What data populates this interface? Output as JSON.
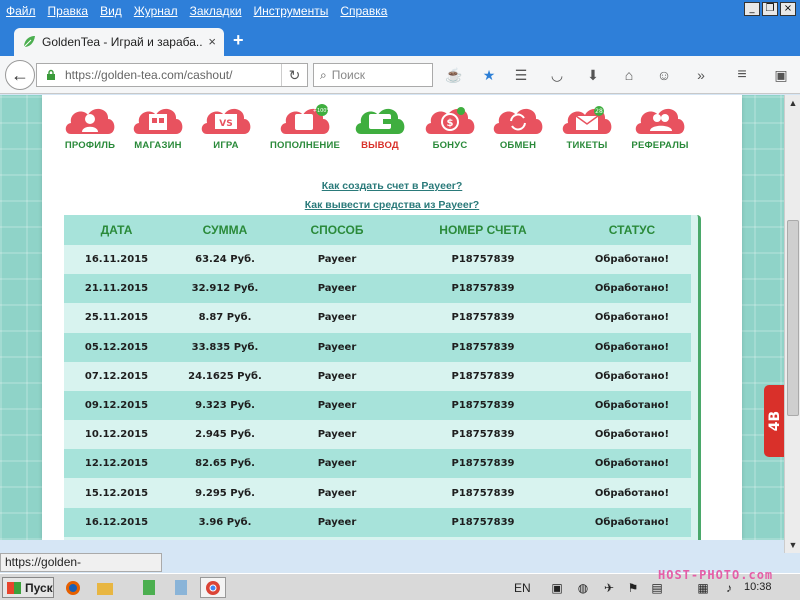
{
  "menubar": {
    "items": [
      "Файл",
      "Правка",
      "Вид",
      "Журнал",
      "Закладки",
      "Инструменты",
      "Справка"
    ]
  },
  "tab": {
    "title": "GoldenTea - Играй и зараба...",
    "close": "×",
    "new_tab": "+"
  },
  "navbar": {
    "url": "https://golden-tea.com/cashout/",
    "search_placeholder": "Поиск"
  },
  "site": {
    "menu": [
      {
        "label": "ПРОФИЛЬ",
        "icon": "profile-icon",
        "color": "#e8525f"
      },
      {
        "label": "МАГАЗИН",
        "icon": "shop-icon",
        "color": "#e8525f"
      },
      {
        "label": "ИГРА",
        "icon": "game-icon",
        "color": "#e8525f",
        "badge": "VS"
      },
      {
        "label": "ПОПОЛНЕНИЕ",
        "icon": "deposit-icon",
        "color": "#e8525f",
        "badge": "+100%"
      },
      {
        "label": "ВЫВОД",
        "icon": "wallet-icon",
        "color": "#3fae3f"
      },
      {
        "label": "БОНУС",
        "icon": "bonus-icon",
        "color": "#e8525f"
      },
      {
        "label": "ОБМЕН",
        "icon": "exchange-icon",
        "color": "#e8525f"
      },
      {
        "label": "ТИКЕТЫ",
        "icon": "tickets-icon",
        "color": "#e8525f",
        "badge": "28"
      },
      {
        "label": "РЕФЕРАЛЫ",
        "icon": "referrals-icon",
        "color": "#e8525f"
      }
    ],
    "links": {
      "create_account": "Как создать счет в Payeer?",
      "withdraw": "Как вывести средства из Payeer?"
    },
    "table": {
      "headers": [
        "ДАТА",
        "СУММА",
        "СПОСОБ",
        "НОМЕР СЧЕТА",
        "СТАТУС"
      ],
      "rows": [
        [
          "16.11.2015",
          "63.24 Руб.",
          "Payeer",
          "P18757839",
          "Обработано!"
        ],
        [
          "21.11.2015",
          "32.912 Руб.",
          "Payeer",
          "P18757839",
          "Обработано!"
        ],
        [
          "25.11.2015",
          "8.87 Руб.",
          "Payeer",
          "P18757839",
          "Обработано!"
        ],
        [
          "05.12.2015",
          "33.835 Руб.",
          "Payeer",
          "P18757839",
          "Обработано!"
        ],
        [
          "07.12.2015",
          "24.1625 Руб.",
          "Payeer",
          "P18757839",
          "Обработано!"
        ],
        [
          "09.12.2015",
          "9.323 Руб.",
          "Payeer",
          "P18757839",
          "Обработано!"
        ],
        [
          "10.12.2015",
          "2.945 Руб.",
          "Payeer",
          "P18757839",
          "Обработано!"
        ],
        [
          "12.12.2015",
          "82.65 Руб.",
          "Payeer",
          "P18757839",
          "Обработано!"
        ],
        [
          "15.12.2015",
          "9.295 Руб.",
          "Payeer",
          "P18757839",
          "Обработано!"
        ],
        [
          "16.12.2015",
          "3.96 Руб.",
          "Payeer",
          "P18757839",
          "Обработано!"
        ]
      ]
    },
    "side_tab": "4B"
  },
  "status_bar": {
    "link": "https://golden-tea.com/cashout"
  },
  "taskbar": {
    "start": "Пуск",
    "lang": "EN",
    "clock": "10:38",
    "watermark": "HOST-PHOTO.com"
  },
  "colors": {
    "menubar": "#2e7fd9",
    "accent_green": "#2a8a3a",
    "page_bg": "#8fd3c8",
    "row_light": "#d8f3ef",
    "row_dark": "#a7e3da"
  }
}
